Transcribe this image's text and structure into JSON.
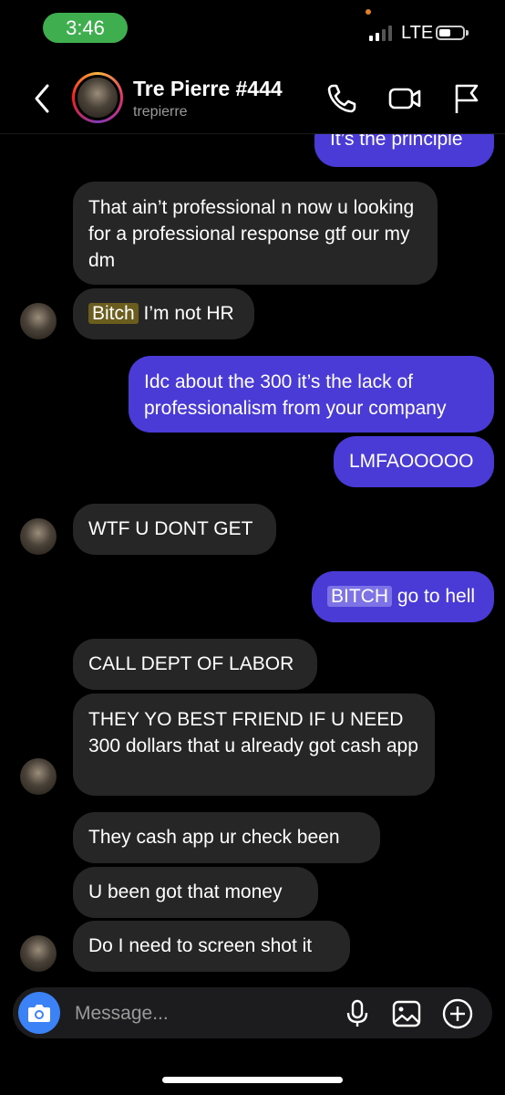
{
  "status_bar": {
    "time": "3:46",
    "network": "LTE"
  },
  "header": {
    "name": "Tre Pierre #444",
    "username": "trepierre"
  },
  "messages": [
    {
      "side": "sent",
      "text": "It’s the principle"
    },
    {
      "side": "received",
      "text": "That ain’t professional n now u looking for a professional response gtf our my dm"
    },
    {
      "side": "received",
      "highlight": "Bitch",
      "text": " I’m not HR"
    },
    {
      "side": "sent",
      "text": "Idc about the 300 it’s the lack of professionalism from your company"
    },
    {
      "side": "sent",
      "text": "LMFAOOOOO"
    },
    {
      "side": "received",
      "text": "WTF U DONT GET"
    },
    {
      "side": "sent",
      "highlight": "BITCH",
      "text": " go to hell"
    },
    {
      "side": "received",
      "text": "CALL DEPT OF LABOR"
    },
    {
      "side": "received",
      "text": "THEY YO BEST FRIEND IF U NEED 300 dollars that u already got cash app"
    },
    {
      "side": "received",
      "text": "They cash app ur check been"
    },
    {
      "side": "received",
      "text": "U been got that money"
    },
    {
      "side": "received",
      "text": "Do I need to screen shot it"
    }
  ],
  "composer": {
    "placeholder": "Message..."
  },
  "colors": {
    "sent_bubble": "#4a3ad6",
    "received_bubble": "#262626",
    "status_time_bg": "#3fae4f",
    "camera_button": "#3b82f6"
  },
  "icons": [
    "back-chevron-icon",
    "phone-icon",
    "video-icon",
    "flag-icon",
    "camera-icon",
    "microphone-icon",
    "gallery-icon",
    "plus-circle-icon"
  ]
}
